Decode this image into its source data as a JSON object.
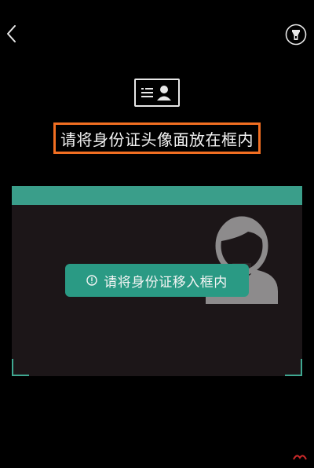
{
  "header": {
    "back_icon": "chevron-left-icon",
    "flash_icon": "flashlight-icon"
  },
  "guide": {
    "card_icon": "id-card-icon",
    "instruction": "请将身份证头像面放在框内",
    "highlight_color": "#f26f22"
  },
  "scanner": {
    "accent_color": "#3a9e8a",
    "placeholder_icon": "person-silhouette-icon",
    "toast": {
      "icon": "alert-circle-icon",
      "text": "请将身份证移入框内"
    }
  }
}
